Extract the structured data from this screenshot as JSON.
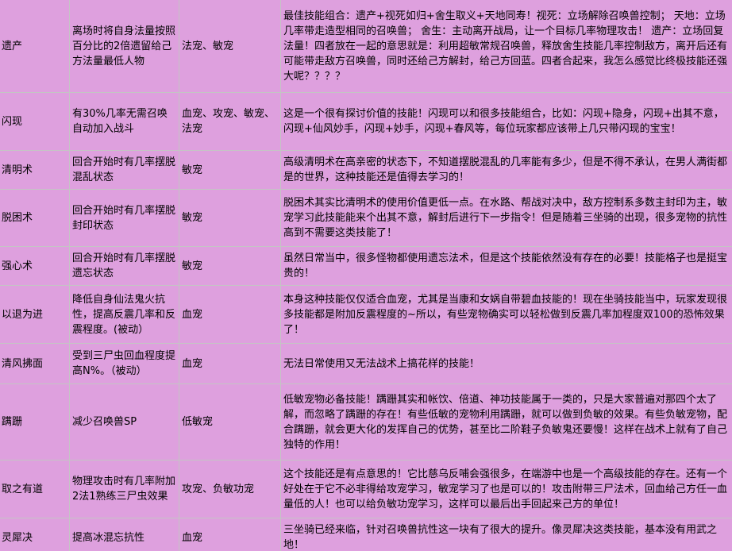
{
  "colors": {
    "cell_background": "#DEA0DE",
    "grid_line": "#C4C4C4",
    "text": "#000000"
  },
  "rows": [
    {
      "name": "遗产",
      "effect": "离场时将自身法量按照百分比的2倍遗留给己方法量最低人物",
      "suitable": "法宠、敏宠",
      "comment": "最佳技能组合：遗产+视死如归+舍生取义+天地同寿！视死：立场解除召唤兽控制； 天地：立场几率带走造型相同的召唤兽； 舍生：主动离开战局，让一个目标几率物理攻击！ 遗产：立场回复法量！四者放在一起的意思就是：利用超敏常规召唤兽，释放舍生技能几率控制敌方，离开后还有可能带走敌方召唤兽，同时还给己方解封，给己方回蓝。四者合起来，我怎么感觉比终极技能还强大呢？？？？"
    },
    {
      "name": "闪现",
      "effect": "有30%几率无需召唤自动加入战斗",
      "suitable": "血宠、攻宠、敏宠、法宠",
      "comment": "这是一个很有探讨价值的技能！闪现可以和很多技能组合，比如：闪现+隐身，闪现+出其不意，闪现+仙风妙手，闪现+妙手，闪现+春风等，每位玩家都应该带上几只带闪现的宝宝！"
    },
    {
      "name": "清明术",
      "effect": "回合开始时有几率摆脱混乱状态",
      "suitable": "敏宠",
      "comment": "高级清明术在高亲密的状态下，不知道摆脱混乱的几率能有多少，但是不得不承认，在男人满街都是的世界，这种技能还是值得去学习的！"
    },
    {
      "name": "脱困术",
      "effect": "回合开始时有几率摆脱封印状态",
      "suitable": "敏宠",
      "comment": "脱困术其实比清明术的使用价值更低一点。在水路、帮战对决中，敌方控制系多数主封印为主，敏宠学习此技能能来个出其不意，解封后进行下一步指令！但是随着三坐骑的出现，很多宠物的抗性高到不需要这类技能了！"
    },
    {
      "name": "强心术",
      "effect": "回合开始时有几率摆脱遗忘状态",
      "suitable": "敏宠",
      "comment": "虽然日常当中，很多怪物都使用遗忘法术，但是这个技能依然没有存在的必要！技能格子也是挺宝贵的！"
    },
    {
      "name": "以退为进",
      "effect": "降低自身仙法鬼火抗性，提高反震几率和反震程度。(被动）",
      "suitable": "血宠",
      "comment": "本身这种技能仅仅适合血宠，尤其是当康和女娲自带碧血技能的！现在坐骑技能当中，玩家发现很多技能都是附加反震程度的~所以，有些宠物确实可以轻松做到反震几率加程度双100的恐怖效果了！"
    },
    {
      "name": "清风拂面",
      "effect": "受到三尸虫回血程度提高N%。（被动）",
      "suitable": "血宠",
      "comment": "无法日常使用又无法战术上搞花样的技能！"
    },
    {
      "name": "蹒跚",
      "effect": "减少召唤兽SP",
      "suitable": "低敏宠",
      "comment": "低敏宠物必备技能！蹒跚其实和帐饮、倍道、神功技能属于一类的，只是大家普遍对那四个太了解，而忽略了蹒跚的存在！有些低敏的宠物利用蹒跚，就可以做到负敏的效果。有些负敏宠物，配合蹒跚，就会更大化的发挥自己的优势，甚至比二阶鞋子负敏鬼还要慢！这样在战术上就有了自己独特的作用！"
    },
    {
      "name": "取之有道",
      "effect": "物理攻击时有几率附加2法1熟练三尸虫效果",
      "suitable": "攻宠、负敏功宠",
      "comment": "这个技能还是有点意思的！它比慈乌反哺会强很多，在端游中也是一个高级技能的存在。还有一个好处在于它不必非得给攻宠学习，敏宠学习了也是可以的！攻击附带三尸法术，回血给己方任一血量低的人！也可以给负敏功宠学习，这样可以最后出手回起来己方的单位！"
    },
    {
      "name": "灵犀决",
      "effect": "提高冰混忘抗性",
      "suitable": "血宠",
      "comment": "三坐骑已经来临，针对召唤兽抗性这一块有了很大的提升。像灵犀决这类技能，基本没有用武之地！"
    }
  ]
}
